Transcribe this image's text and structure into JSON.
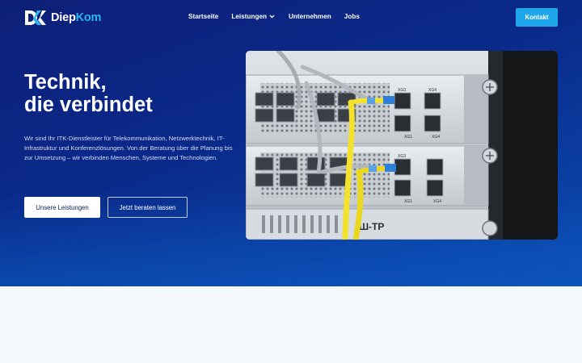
{
  "brand": {
    "name_part1": "Diep",
    "name_part2": "Kom",
    "logo_icon": "dk-monogram-icon",
    "accent_color": "#2bb6f0"
  },
  "nav": {
    "items": [
      {
        "label": "Startseite"
      },
      {
        "label": "Leistungen",
        "has_dropdown": true
      },
      {
        "label": "Unternehmen"
      },
      {
        "label": "Jobs"
      }
    ],
    "contact_label": "Kontakt"
  },
  "hero": {
    "title_line1": "Technik,",
    "title_line2": "die verbindet",
    "description": "Wir sind Ihr ITK-Dienstleister für Telekommunikation, Netzwerktechnik, IT-Infrastruktur und Konferenzlösungen. Von der Beratung über die Planung bis zur Umsetzung – wir verbinden Menschen, Systeme und Technologien.",
    "primary_button": "Unsere Leistungen",
    "secondary_button": "Jetzt beraten lassen",
    "image": {
      "subject": "network-switch-rack-photo",
      "port_labels": [
        "XG3",
        "XG4",
        "XG1",
        "XG4",
        "XG3",
        "XG1",
        "XG4"
      ],
      "device_label": "Ш-TP"
    }
  },
  "colors": {
    "hero_top": "#0d1f78",
    "hero_bottom": "#0b4db4",
    "contact_button": "#1ea7ea",
    "page_background": "#f5f9fc"
  }
}
